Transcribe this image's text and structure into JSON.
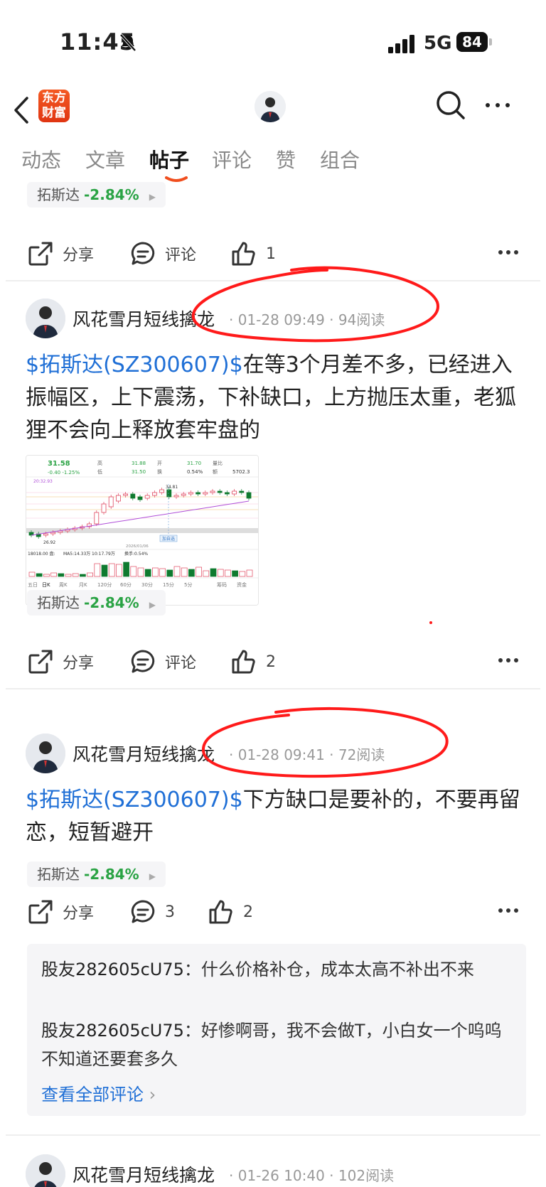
{
  "status": {
    "time": "11:45",
    "network": "5G",
    "battery": "84"
  },
  "nav": {
    "logo_line1": "东方",
    "logo_line2": "财富"
  },
  "tabs": [
    "动态",
    "文章",
    "帖子",
    "评论",
    "赞",
    "组合"
  ],
  "active_tab": "帖子",
  "stock_tag": {
    "name": "拓斯达",
    "change": "-2.84%"
  },
  "actions": {
    "share": "分享",
    "comment": "评论"
  },
  "posts": [
    {
      "like_count": "1"
    },
    {
      "author": "风花雪月短线擒龙",
      "meta": "· 01-28 09:49 · 94阅读",
      "link": "$拓斯达(SZ300607)$",
      "text": "在等3个月差不多，已经进入振幅区，上下震荡，下补缺口，上方抛压太重，老狐狸不会向上释放套牢盘的",
      "like_count": "2",
      "chart": {
        "price": "31.58",
        "chg": "-0.40 -1.25%",
        "high_label": "高",
        "high": "31.88",
        "low_label": "低",
        "low": "31.50",
        "open_label": "开",
        "open": "31.70",
        "turn_label": "换",
        "turn": "0.54%",
        "vr_label": "量比",
        "amt_label": "额",
        "amt": "5702.3",
        "ma_text": "20:32.93",
        "peak": "34.81",
        "trough": "26.92",
        "date": "2026/01/06",
        "add_label": "加自选",
        "vol_text": "18018.00 盘:",
        "ma5": "MA5:14.33万",
        "ma10": "10:17.79万",
        "turn2": "换手:0.54%",
        "periods": [
          "五日",
          "日K",
          "周K",
          "月K",
          "120分",
          "60分",
          "30分",
          "15分",
          "5分",
          "筹码",
          "资金"
        ]
      }
    },
    {
      "author": "风花雪月短线擒龙",
      "meta": "· 01-28 09:41 · 72阅读",
      "link": "$拓斯达(SZ300607)$",
      "text": "下方缺口是要补的，不要再留恋，短暂避开",
      "comment_count": "3",
      "like_count": "2",
      "comments": [
        {
          "user": "股友282605cU75",
          "sep": "：",
          "text": "什么价格补仓，成本太高不补出不来"
        },
        {
          "user": "股友282605cU75",
          "sep": "：",
          "text": "好惨啊哥，我不会做T，小白女一个呜呜不知道还要套多久"
        }
      ],
      "view_all": "查看全部评论"
    },
    {
      "author": "风花雪月短线擒龙",
      "meta": "· 01-26 10:40 · 102阅读"
    }
  ],
  "colors": {
    "accent_link": "#1f6fd6",
    "down_green": "#2aa344",
    "annotation_red": "#ff1a1a",
    "logo_orange": "#f04e1e"
  }
}
